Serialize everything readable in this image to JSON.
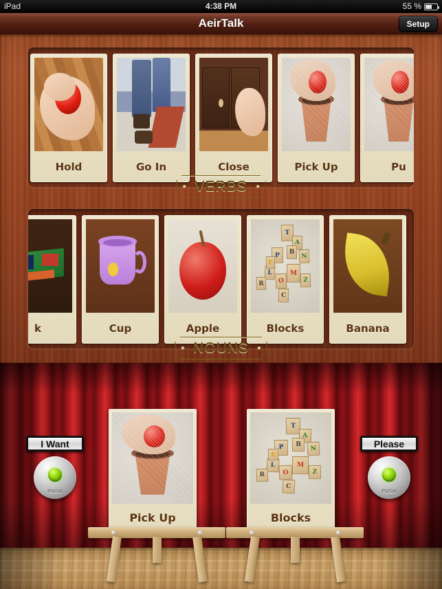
{
  "status_bar": {
    "device": "iPad",
    "time": "4:38 PM",
    "battery_percent": "55 %"
  },
  "title_bar": {
    "app_title": "AeirTalk",
    "setup_label": "Setup"
  },
  "categories": [
    {
      "plaque_label": "VERBS",
      "cards": [
        {
          "label": "Hold",
          "art": "hold",
          "partial": "none"
        },
        {
          "label": "Go In",
          "art": "goin",
          "partial": "none"
        },
        {
          "label": "Close",
          "art": "close",
          "partial": "none"
        },
        {
          "label": "Pick Up",
          "art": "pickup",
          "partial": "none"
        },
        {
          "label": "Pu",
          "art": "putin",
          "partial": "right"
        }
      ]
    },
    {
      "plaque_label": "NOUNS",
      "cards": [
        {
          "label": "k",
          "art": "book",
          "partial": "left"
        },
        {
          "label": "Cup",
          "art": "cup",
          "partial": "none"
        },
        {
          "label": "Apple",
          "art": "apple",
          "partial": "none"
        },
        {
          "label": "Blocks",
          "art": "blocks",
          "partial": "none"
        },
        {
          "label": "Banana",
          "art": "banana",
          "partial": "right"
        }
      ]
    }
  ],
  "stage": {
    "left_button": {
      "label": "I Want",
      "push_label": "PUSH"
    },
    "right_button": {
      "label": "Please",
      "push_label": "PUSH"
    },
    "sentence_cards": [
      {
        "label": "Pick Up",
        "art": "pickup"
      },
      {
        "label": "Blocks",
        "art": "blocks"
      }
    ]
  },
  "colors": {
    "wood": "#9b441f",
    "curtain": "#a81a1e",
    "card_paper": "#efe7cb",
    "plaque_gold": "#c79e2f",
    "caption_text": "#5a3310",
    "led_green": "#9fe016"
  }
}
